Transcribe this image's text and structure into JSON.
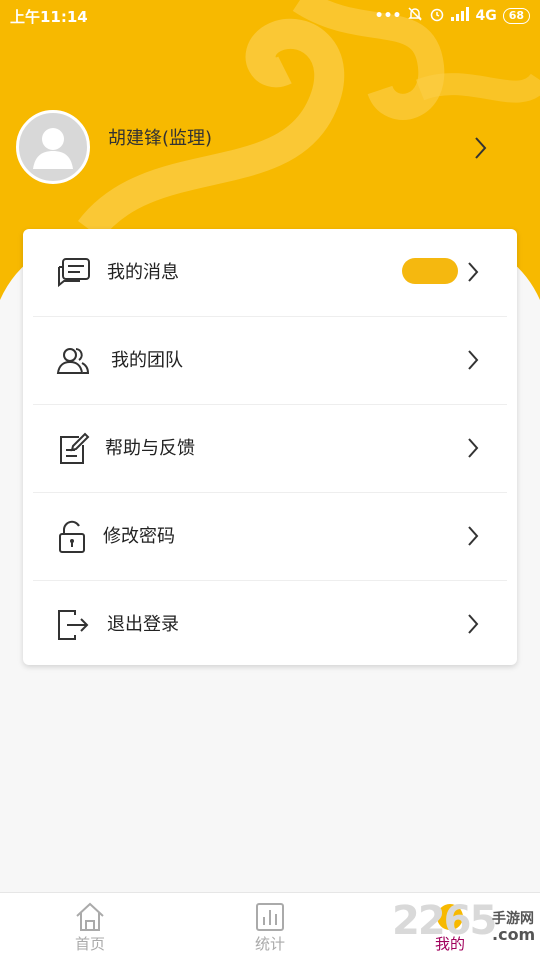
{
  "colors": {
    "accent": "#f7b900",
    "badge": "#f5b80f",
    "active_tab": "#a0005c"
  },
  "status_bar": {
    "time": "上午11:14",
    "network": "4G",
    "battery": "68"
  },
  "profile": {
    "name": "胡建锋(监理)"
  },
  "menu": [
    {
      "label": "我的消息",
      "icon": "message-icon"
    },
    {
      "label": "我的团队",
      "icon": "team-icon"
    },
    {
      "label": "帮助与反馈",
      "icon": "feedback-icon"
    },
    {
      "label": "修改密码",
      "icon": "lock-icon"
    },
    {
      "label": "退出登录",
      "icon": "logout-icon"
    }
  ],
  "tabs": [
    {
      "label": "首页",
      "icon": "home-icon"
    },
    {
      "label": "统计",
      "icon": "stats-icon"
    },
    {
      "label": "我的",
      "icon": "profile-icon",
      "active": true
    }
  ],
  "watermark": {
    "text": "2265",
    "sub": "手游网",
    "domain": ".com"
  }
}
